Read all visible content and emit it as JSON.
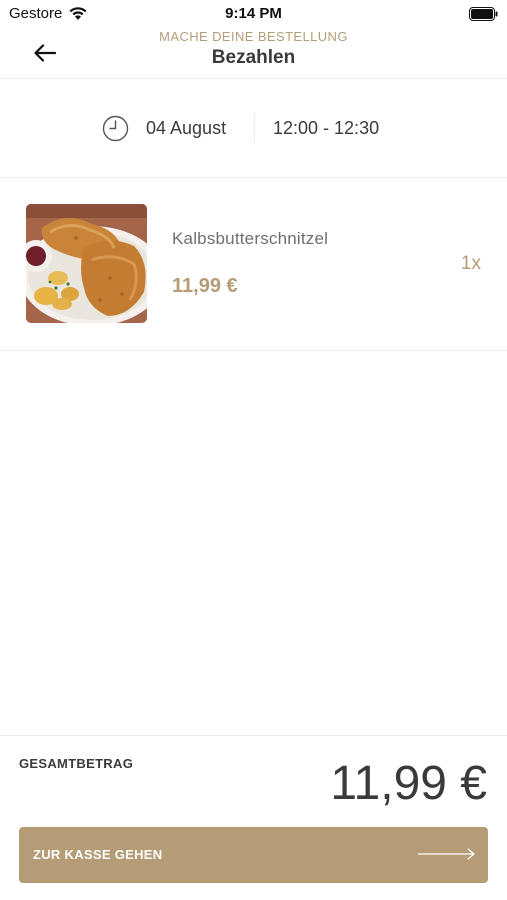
{
  "status_bar": {
    "carrier": "Gestore",
    "time": "9:14 PM"
  },
  "header": {
    "subtitle": "MACHE DEINE BESTELLUNG",
    "title": "Bezahlen",
    "back_icon": "arrow-left-icon"
  },
  "schedule": {
    "icon": "clock-icon",
    "date": "04 August",
    "time_slot": "12:00 - 12:30"
  },
  "order": {
    "items": [
      {
        "name": "Kalbsbutterschnitzel",
        "price": "11,99 €",
        "quantity": "1x",
        "image": "schnitzel-photo"
      }
    ]
  },
  "footer": {
    "total_label": "GESAMTBETRAG",
    "total_value": "11,99 €",
    "checkout_label": "ZUR KASSE GEHEN",
    "checkout_icon": "arrow-right-icon"
  },
  "colors": {
    "accent": "#b59c77",
    "text": "#3b3b3b",
    "divider": "#ececec"
  }
}
